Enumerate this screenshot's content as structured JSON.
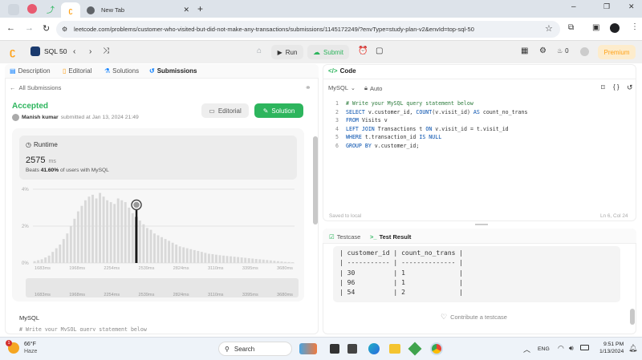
{
  "browser": {
    "tabs": [
      {
        "title": "New Tab"
      }
    ],
    "url": "leetcode.com/problems/customer-who-visited-but-did-not-make-any-transactions/submissions/1145172249/?envType=study-plan-v2&envId=top-sql-50"
  },
  "header": {
    "study_plan": "SQL 50",
    "run_label": "Run",
    "submit_label": "Submit",
    "streak": "0",
    "premium_label": "Premium"
  },
  "left_tabs": [
    "Description",
    "Editorial",
    "Solutions",
    "Submissions"
  ],
  "back_label": "All Submissions",
  "submission": {
    "status": "Accepted",
    "author": "Manish kumar",
    "submitted_text": "submitted at Jan 13, 2024 21:49",
    "editorial_button": "Editorial",
    "solution_button": "Solution"
  },
  "runtime": {
    "title": "Runtime",
    "value": "2575",
    "unit": "ms",
    "beats_prefix": "Beats",
    "beats_pct": "41.60%",
    "beats_suffix": "of users with MySQL"
  },
  "chart_data": {
    "type": "bar",
    "y_ticks": [
      "4%",
      "2%",
      "0%"
    ],
    "ylim": [
      0,
      4
    ],
    "x_ticks": [
      "1683ms",
      "1968ms",
      "2254ms",
      "2539ms",
      "2824ms",
      "3110ms",
      "3395ms",
      "3680ms"
    ],
    "values": [
      0.1,
      0.15,
      0.2,
      0.3,
      0.4,
      0.6,
      0.8,
      1.0,
      1.3,
      1.6,
      2.0,
      2.4,
      2.8,
      3.1,
      3.4,
      3.6,
      3.7,
      3.5,
      3.8,
      3.6,
      3.4,
      3.3,
      3.2,
      3.5,
      3.4,
      3.3,
      3.0,
      2.7,
      2.5,
      2.3,
      2.1,
      1.9,
      1.8,
      1.6,
      1.5,
      1.4,
      1.3,
      1.2,
      1.1,
      1.0,
      0.9,
      0.85,
      0.8,
      0.75,
      0.7,
      0.65,
      0.6,
      0.55,
      0.5,
      0.48,
      0.45,
      0.42,
      0.4,
      0.38,
      0.36,
      0.34,
      0.32,
      0.3,
      0.28,
      0.26,
      0.24,
      0.22,
      0.2,
      0.18,
      0.16,
      0.14,
      0.12,
      0.1,
      0.08,
      0.06,
      0.05,
      0.04
    ],
    "highlight_index": 28
  },
  "code_lang": "MySQL",
  "code_section_label": "MySQL",
  "code_preview": "# Write your MySQL query statement below",
  "editor": {
    "title": "Code",
    "lang": "MySQL",
    "mode": "Auto",
    "lines": [
      "# Write your MySQL query statement below",
      "SELECT v.customer_id, COUNT(v.visit_id) AS count_no_trans",
      "FROM Visits v",
      "LEFT JOIN Transactions t ON v.visit_id = t.visit_id",
      "WHERE t.transaction_id IS NULL",
      "GROUP BY v.customer_id;"
    ],
    "saved": "Saved to local",
    "cursor": "Ln 6, Col 24"
  },
  "test": {
    "testcase_tab": "Testcase",
    "result_tab": "Test Result",
    "table_lines": [
      "| customer_id | count_no_trans |",
      "| ----------- | -------------- |",
      "| 30          | 1              |",
      "| 96          | 1              |",
      "| 54          | 2              |"
    ],
    "contribute": "Contribute a testcase"
  },
  "taskbar": {
    "weather_temp": "66°F",
    "weather_desc": "Haze",
    "weather_badge": "1",
    "search_placeholder": "Search",
    "lang": "ENG",
    "time": "9:51 PM",
    "date": "1/13/2024"
  },
  "colors": {
    "accent": "#2db55d",
    "brand": "#ffa116",
    "blue": "#007aff"
  }
}
